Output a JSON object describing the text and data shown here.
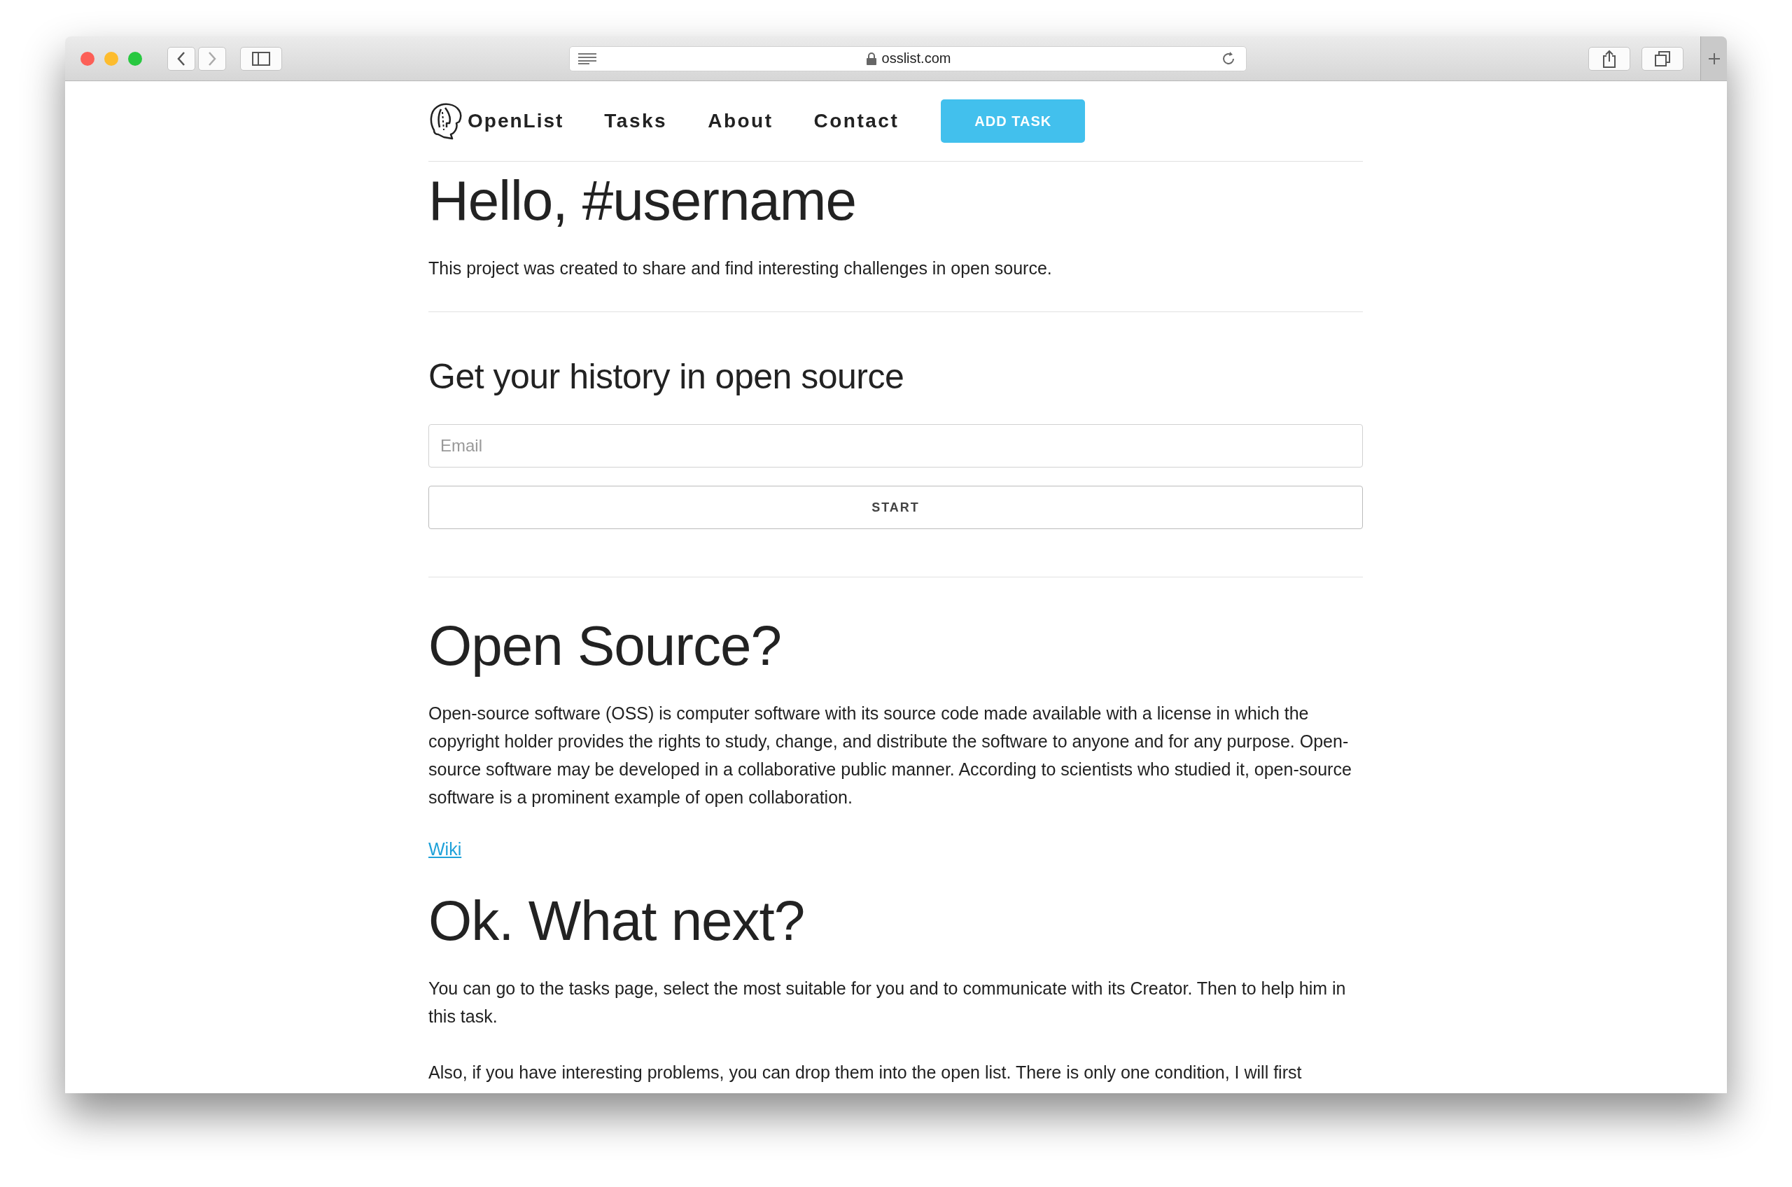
{
  "browser": {
    "url": "osslist.com"
  },
  "nav": {
    "brand": "OpenList",
    "links": [
      "Tasks",
      "About",
      "Contact"
    ],
    "button": "ADD TASK"
  },
  "hero": {
    "title": "Hello, #username",
    "text": "This project was created to share and find interesting challenges in open source."
  },
  "signup": {
    "title": "Get your history in open source",
    "placeholder": "Email",
    "button": "START"
  },
  "sections": [
    {
      "title": "Open Source?",
      "paragraphs": [
        "Open-source software (OSS) is computer software with its source code made available with a license in which the copyright holder provides the rights to study, change, and distribute the software to anyone and for any purpose. Open-source software may be developed in a collaborative public manner. According to scientists who studied it, open-source software is a prominent example of open collaboration."
      ],
      "link": "Wiki"
    },
    {
      "title": "Ok. What next?",
      "paragraphs": [
        "You can go to the tasks page, select the most suitable for you and to communicate with its Creator. Then to help him in this task.",
        "Also, if you have interesting problems, you can drop them into the open list. There is only one condition, I will first"
      ]
    }
  ]
}
